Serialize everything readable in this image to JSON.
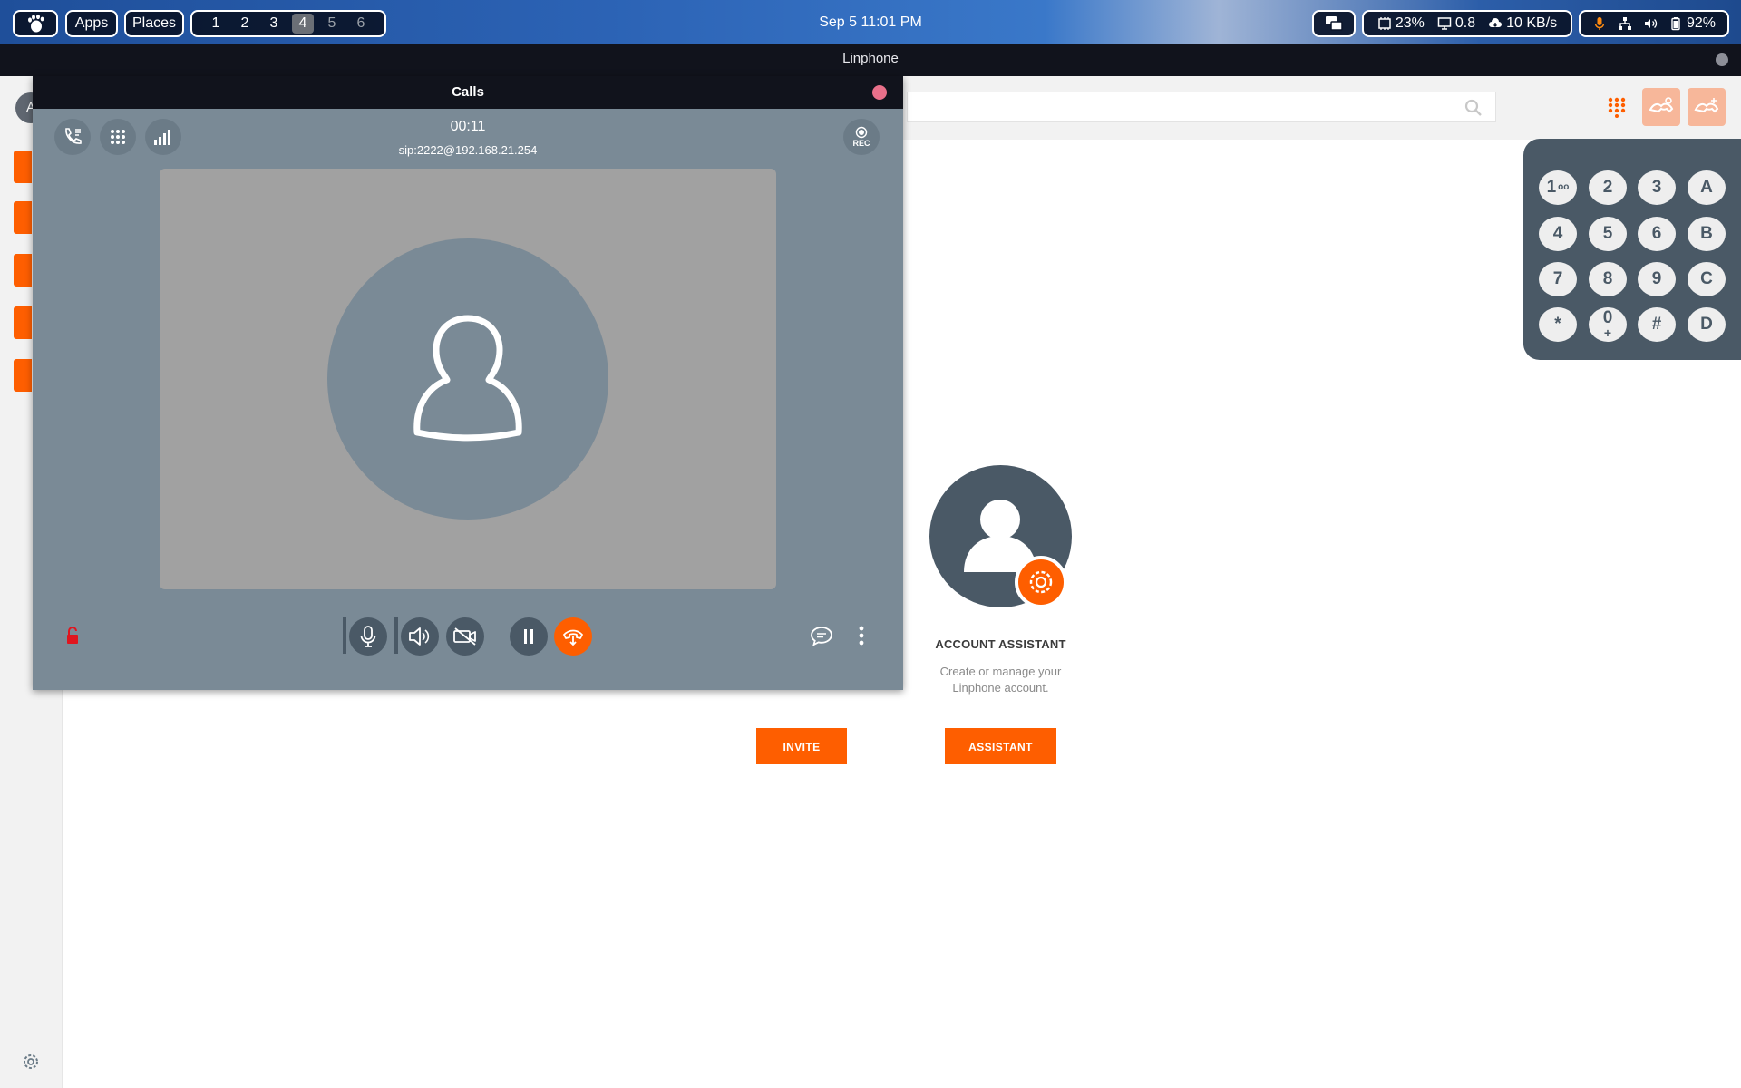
{
  "top_panel": {
    "apps_label": "Apps",
    "places_label": "Places",
    "workspaces": [
      "1",
      "2",
      "3",
      "4",
      "5",
      "6"
    ],
    "active_workspace": "4",
    "clock": "Sep 5  11:01 PM",
    "cpu": "23%",
    "load": "0.8",
    "network": "10 KB/s",
    "battery": "92%"
  },
  "main_window": {
    "title": "Linphone",
    "avatar_initial": "A",
    "search_placeholder": ""
  },
  "home": {
    "assistant_title": "ACCOUNT ASSISTANT",
    "assistant_desc": "Create or manage your Linphone account.",
    "invite_label": "INVITE",
    "assistant_label": "ASSISTANT"
  },
  "dialpad": {
    "keys": [
      "1",
      "2",
      "3",
      "A",
      "4",
      "5",
      "6",
      "B",
      "7",
      "8",
      "9",
      "C",
      "*",
      "0",
      "#",
      "D"
    ],
    "key1_sub": "oo",
    "key0_sub": "+"
  },
  "calls_window": {
    "title": "Calls",
    "timer": "00:11",
    "sip_address": "sip:2222@192.168.21.254",
    "rec_label": "REC"
  },
  "colors": {
    "accent": "#fe5e00",
    "call_bg": "#7a8a96",
    "dark_control": "#4a5966",
    "lock_red": "#e0151e"
  }
}
